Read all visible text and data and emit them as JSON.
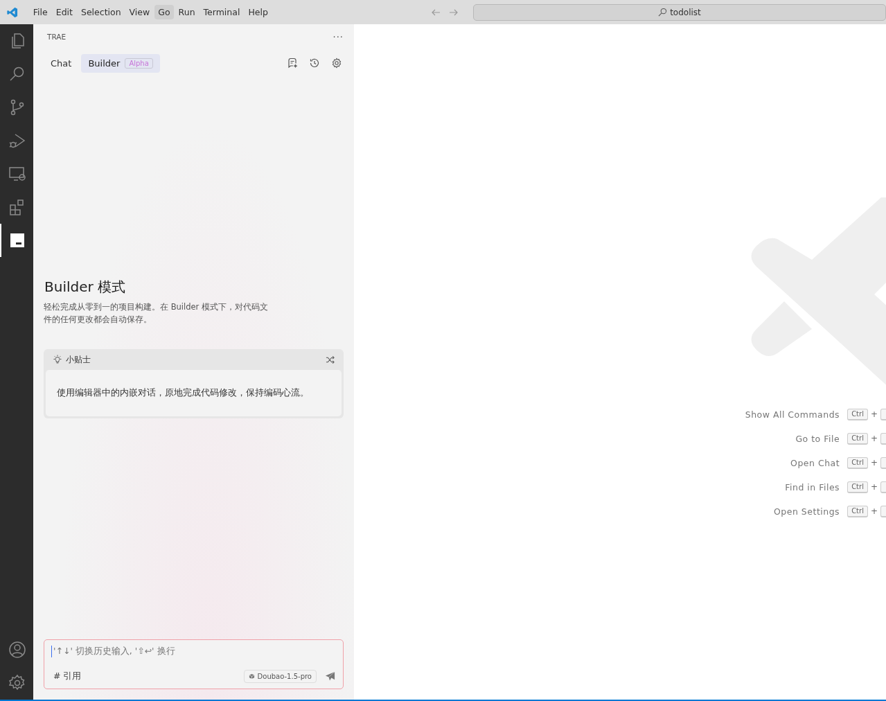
{
  "menu_bar": {
    "items": [
      {
        "label": "File",
        "selected": false
      },
      {
        "label": "Edit",
        "selected": false
      },
      {
        "label": "Selection",
        "selected": false
      },
      {
        "label": "View",
        "selected": false
      },
      {
        "label": "Go",
        "selected": true
      },
      {
        "label": "Run",
        "selected": false
      },
      {
        "label": "Terminal",
        "selected": false
      },
      {
        "label": "Help",
        "selected": false
      }
    ]
  },
  "command_center": {
    "value": "todolist"
  },
  "activity_bar": {
    "items": [
      {
        "kind": "files",
        "selected": false
      },
      {
        "kind": "search",
        "selected": false
      },
      {
        "kind": "source-control",
        "selected": false
      },
      {
        "kind": "run-debug",
        "selected": false
      },
      {
        "kind": "remote",
        "selected": false
      },
      {
        "kind": "extensions",
        "selected": false
      },
      {
        "kind": "trae",
        "selected": true
      }
    ],
    "bottom": [
      {
        "kind": "account"
      },
      {
        "kind": "settings"
      }
    ]
  },
  "sidebar": {
    "title": "TRAE",
    "more": "···",
    "tabs": [
      {
        "label": "Chat",
        "selected": false
      },
      {
        "label": "Builder",
        "selected": true,
        "badge": "Alpha"
      }
    ],
    "heading": "Builder 模式",
    "description": "轻松完成从零到一的项目构建。在 Builder 模式下，对代码文件的任何更改都会自动保存。",
    "tip": {
      "title": "小贴士",
      "text": "使用编辑器中的内嵌对话，原地完成代码修改，保持编码心流。"
    },
    "input": {
      "placeholder": "'↑↓' 切换历史输入, '⇧↩' 换行",
      "reference": "# 引用",
      "model": "Doubao-1.5-pro"
    }
  },
  "editor": {
    "shortcuts": [
      {
        "label": "Show All Commands",
        "key": "Ctrl",
        "plus": "+"
      },
      {
        "label": "Go to File",
        "key": "Ctrl",
        "plus": "+"
      },
      {
        "label": "Open Chat",
        "key": "Ctrl",
        "plus": "+"
      },
      {
        "label": "Find in Files",
        "key": "Ctrl",
        "plus": "+"
      },
      {
        "label": "Open Settings",
        "key": "Ctrl",
        "plus": "+"
      }
    ]
  }
}
